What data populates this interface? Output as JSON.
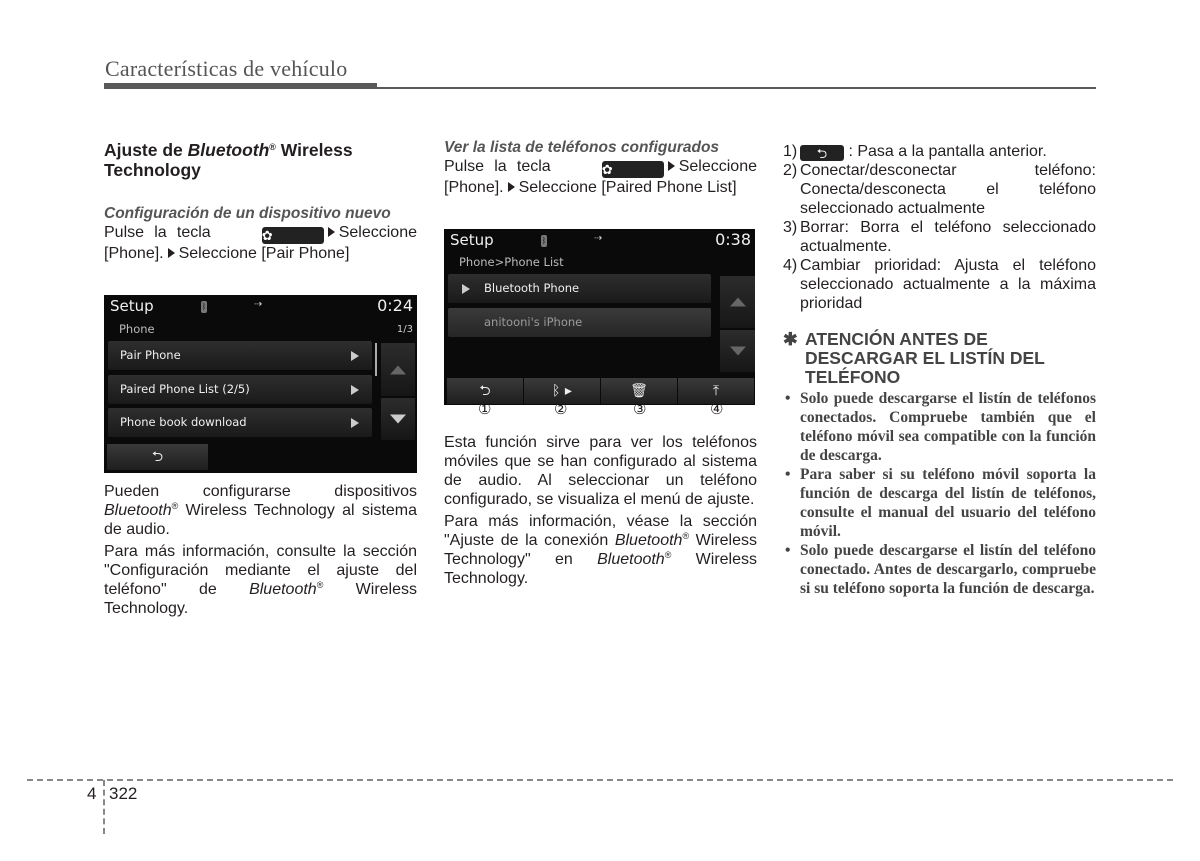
{
  "header": {
    "title": "Características de vehículo"
  },
  "col1": {
    "heading_pre": "Ajuste de ",
    "heading_italic": "Bluetooth",
    "heading_reg": "®",
    "heading_post": " Wireless Technology",
    "subheading": "Configuración de un dispositivo nuevo",
    "instr_pre": "Pulse la tecla",
    "instr_mid": "Seleccione [Phone].",
    "instr_end": "Seleccione [Pair Phone]",
    "screen": {
      "title": "Setup",
      "time": "0:24",
      "breadcrumb": "Phone",
      "page": "1/3",
      "items": [
        "Pair Phone",
        "Paired Phone List  (2/5)",
        "Phone book download"
      ],
      "back_icon": "back-arrow-icon"
    },
    "p1_a": "Pueden configurarse dispositivos ",
    "p1_italic": "Bluetooth",
    "p1_b": " Wireless Technology al sistema de audio.",
    "p2_a": "Para más información, consulte la sección \"Configuración mediante el ajuste del teléfono\" de ",
    "p2_italic": "Bluetooth",
    "p2_b": " Wireless Technology."
  },
  "col2": {
    "subheading": "Ver la lista de teléfonos configurados",
    "instr_pre": "Pulse la tecla",
    "instr_mid": "Seleccione [Phone].",
    "instr_end": "Seleccione [Paired Phone List]",
    "screen": {
      "title": "Setup",
      "time": "0:38",
      "breadcrumb": "Phone>Phone List",
      "items": [
        "Bluetooth Phone",
        "anitooni's iPhone"
      ],
      "buttons": [
        "back-icon",
        "bluetooth-connect-icon",
        "trash-icon",
        "priority-icon"
      ],
      "callouts": [
        "①",
        "②",
        "③",
        "④"
      ]
    },
    "p1": "Esta función sirve para ver los teléfonos móviles que se han configurado al sistema de audio. Al seleccionar un teléfono configurado, se visualiza el menú de ajuste.",
    "p2_a": "Para más información, véase la sección \"Ajuste de la conexión ",
    "p2_italic1": "Bluetooth",
    "p2_b": " Wireless Technology\" en ",
    "p2_italic2": "Bluetooth",
    "p2_c": " Wireless Technology."
  },
  "col3": {
    "items": [
      {
        "n": "1)",
        "text": " : Pasa a la pantalla anterior."
      },
      {
        "n": "2)",
        "text": "Conectar/desconectar teléfono: Conecta/desconecta el teléfono seleccionado actualmente"
      },
      {
        "n": "3)",
        "text": "Borrar: Borra el teléfono seleccionado actualmente."
      },
      {
        "n": "4)",
        "text": "Cambiar prioridad: Ajusta el teléfono seleccionado actualmente a la máxima prioridad"
      }
    ],
    "attention_star": "✱",
    "attention_title": "ATENCIÓN ANTES DE DESCARGAR EL LISTÍN DEL TELÉFONO",
    "bullets": [
      "Solo puede descargarse el listín de teléfonos conectados. Compruebe también que el teléfono móvil sea compatible con la función de descarga.",
      "Para saber si su teléfono móvil soporta la función de descarga del listín de teléfonos, consulte el manual del usuario del teléfono móvil.",
      "Solo puede descargarse el listín del teléfono conectado. Antes de descargarlo, compruebe si su teléfono soporta la función de descarga."
    ]
  },
  "footer": {
    "chapter": "4",
    "page": "322"
  }
}
